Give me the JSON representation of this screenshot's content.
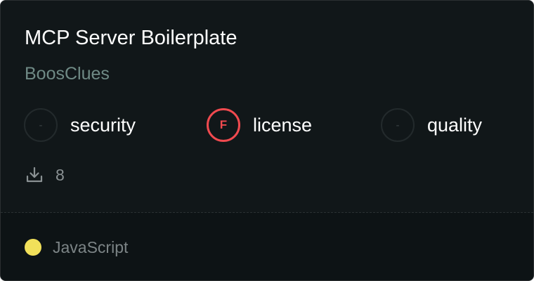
{
  "card": {
    "title": "MCP Server Boilerplate",
    "owner": "BoosClues"
  },
  "scores": [
    {
      "grade": "-",
      "label": "security",
      "status": "none"
    },
    {
      "grade": "F",
      "label": "license",
      "status": "fail",
      "color": "#f04a4f"
    },
    {
      "grade": "-",
      "label": "quality",
      "status": "none"
    }
  ],
  "stats": {
    "downloads_icon": "download-icon",
    "downloads": "8"
  },
  "footer": {
    "language": "JavaScript",
    "language_color": "#f1e05a"
  }
}
